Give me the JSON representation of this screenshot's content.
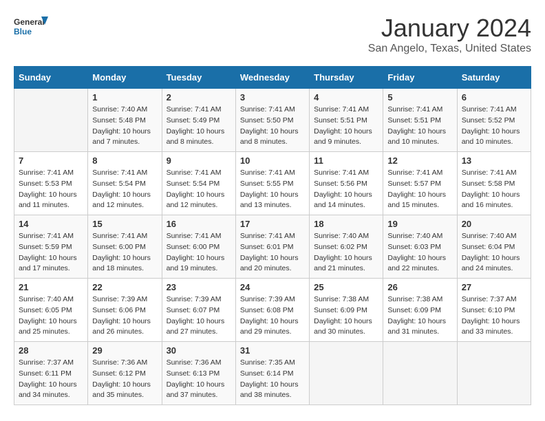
{
  "header": {
    "logo_general": "General",
    "logo_blue": "Blue",
    "month_title": "January 2024",
    "location": "San Angelo, Texas, United States"
  },
  "days_of_week": [
    "Sunday",
    "Monday",
    "Tuesday",
    "Wednesday",
    "Thursday",
    "Friday",
    "Saturday"
  ],
  "weeks": [
    [
      {
        "day": "",
        "sunrise": "",
        "sunset": "",
        "daylight": ""
      },
      {
        "day": "1",
        "sunrise": "Sunrise: 7:40 AM",
        "sunset": "Sunset: 5:48 PM",
        "daylight": "Daylight: 10 hours and 7 minutes."
      },
      {
        "day": "2",
        "sunrise": "Sunrise: 7:41 AM",
        "sunset": "Sunset: 5:49 PM",
        "daylight": "Daylight: 10 hours and 8 minutes."
      },
      {
        "day": "3",
        "sunrise": "Sunrise: 7:41 AM",
        "sunset": "Sunset: 5:50 PM",
        "daylight": "Daylight: 10 hours and 8 minutes."
      },
      {
        "day": "4",
        "sunrise": "Sunrise: 7:41 AM",
        "sunset": "Sunset: 5:51 PM",
        "daylight": "Daylight: 10 hours and 9 minutes."
      },
      {
        "day": "5",
        "sunrise": "Sunrise: 7:41 AM",
        "sunset": "Sunset: 5:51 PM",
        "daylight": "Daylight: 10 hours and 10 minutes."
      },
      {
        "day": "6",
        "sunrise": "Sunrise: 7:41 AM",
        "sunset": "Sunset: 5:52 PM",
        "daylight": "Daylight: 10 hours and 10 minutes."
      }
    ],
    [
      {
        "day": "7",
        "sunrise": "Sunrise: 7:41 AM",
        "sunset": "Sunset: 5:53 PM",
        "daylight": "Daylight: 10 hours and 11 minutes."
      },
      {
        "day": "8",
        "sunrise": "Sunrise: 7:41 AM",
        "sunset": "Sunset: 5:54 PM",
        "daylight": "Daylight: 10 hours and 12 minutes."
      },
      {
        "day": "9",
        "sunrise": "Sunrise: 7:41 AM",
        "sunset": "Sunset: 5:54 PM",
        "daylight": "Daylight: 10 hours and 12 minutes."
      },
      {
        "day": "10",
        "sunrise": "Sunrise: 7:41 AM",
        "sunset": "Sunset: 5:55 PM",
        "daylight": "Daylight: 10 hours and 13 minutes."
      },
      {
        "day": "11",
        "sunrise": "Sunrise: 7:41 AM",
        "sunset": "Sunset: 5:56 PM",
        "daylight": "Daylight: 10 hours and 14 minutes."
      },
      {
        "day": "12",
        "sunrise": "Sunrise: 7:41 AM",
        "sunset": "Sunset: 5:57 PM",
        "daylight": "Daylight: 10 hours and 15 minutes."
      },
      {
        "day": "13",
        "sunrise": "Sunrise: 7:41 AM",
        "sunset": "Sunset: 5:58 PM",
        "daylight": "Daylight: 10 hours and 16 minutes."
      }
    ],
    [
      {
        "day": "14",
        "sunrise": "Sunrise: 7:41 AM",
        "sunset": "Sunset: 5:59 PM",
        "daylight": "Daylight: 10 hours and 17 minutes."
      },
      {
        "day": "15",
        "sunrise": "Sunrise: 7:41 AM",
        "sunset": "Sunset: 6:00 PM",
        "daylight": "Daylight: 10 hours and 18 minutes."
      },
      {
        "day": "16",
        "sunrise": "Sunrise: 7:41 AM",
        "sunset": "Sunset: 6:00 PM",
        "daylight": "Daylight: 10 hours and 19 minutes."
      },
      {
        "day": "17",
        "sunrise": "Sunrise: 7:41 AM",
        "sunset": "Sunset: 6:01 PM",
        "daylight": "Daylight: 10 hours and 20 minutes."
      },
      {
        "day": "18",
        "sunrise": "Sunrise: 7:40 AM",
        "sunset": "Sunset: 6:02 PM",
        "daylight": "Daylight: 10 hours and 21 minutes."
      },
      {
        "day": "19",
        "sunrise": "Sunrise: 7:40 AM",
        "sunset": "Sunset: 6:03 PM",
        "daylight": "Daylight: 10 hours and 22 minutes."
      },
      {
        "day": "20",
        "sunrise": "Sunrise: 7:40 AM",
        "sunset": "Sunset: 6:04 PM",
        "daylight": "Daylight: 10 hours and 24 minutes."
      }
    ],
    [
      {
        "day": "21",
        "sunrise": "Sunrise: 7:40 AM",
        "sunset": "Sunset: 6:05 PM",
        "daylight": "Daylight: 10 hours and 25 minutes."
      },
      {
        "day": "22",
        "sunrise": "Sunrise: 7:39 AM",
        "sunset": "Sunset: 6:06 PM",
        "daylight": "Daylight: 10 hours and 26 minutes."
      },
      {
        "day": "23",
        "sunrise": "Sunrise: 7:39 AM",
        "sunset": "Sunset: 6:07 PM",
        "daylight": "Daylight: 10 hours and 27 minutes."
      },
      {
        "day": "24",
        "sunrise": "Sunrise: 7:39 AM",
        "sunset": "Sunset: 6:08 PM",
        "daylight": "Daylight: 10 hours and 29 minutes."
      },
      {
        "day": "25",
        "sunrise": "Sunrise: 7:38 AM",
        "sunset": "Sunset: 6:09 PM",
        "daylight": "Daylight: 10 hours and 30 minutes."
      },
      {
        "day": "26",
        "sunrise": "Sunrise: 7:38 AM",
        "sunset": "Sunset: 6:09 PM",
        "daylight": "Daylight: 10 hours and 31 minutes."
      },
      {
        "day": "27",
        "sunrise": "Sunrise: 7:37 AM",
        "sunset": "Sunset: 6:10 PM",
        "daylight": "Daylight: 10 hours and 33 minutes."
      }
    ],
    [
      {
        "day": "28",
        "sunrise": "Sunrise: 7:37 AM",
        "sunset": "Sunset: 6:11 PM",
        "daylight": "Daylight: 10 hours and 34 minutes."
      },
      {
        "day": "29",
        "sunrise": "Sunrise: 7:36 AM",
        "sunset": "Sunset: 6:12 PM",
        "daylight": "Daylight: 10 hours and 35 minutes."
      },
      {
        "day": "30",
        "sunrise": "Sunrise: 7:36 AM",
        "sunset": "Sunset: 6:13 PM",
        "daylight": "Daylight: 10 hours and 37 minutes."
      },
      {
        "day": "31",
        "sunrise": "Sunrise: 7:35 AM",
        "sunset": "Sunset: 6:14 PM",
        "daylight": "Daylight: 10 hours and 38 minutes."
      },
      {
        "day": "",
        "sunrise": "",
        "sunset": "",
        "daylight": ""
      },
      {
        "day": "",
        "sunrise": "",
        "sunset": "",
        "daylight": ""
      },
      {
        "day": "",
        "sunrise": "",
        "sunset": "",
        "daylight": ""
      }
    ]
  ]
}
